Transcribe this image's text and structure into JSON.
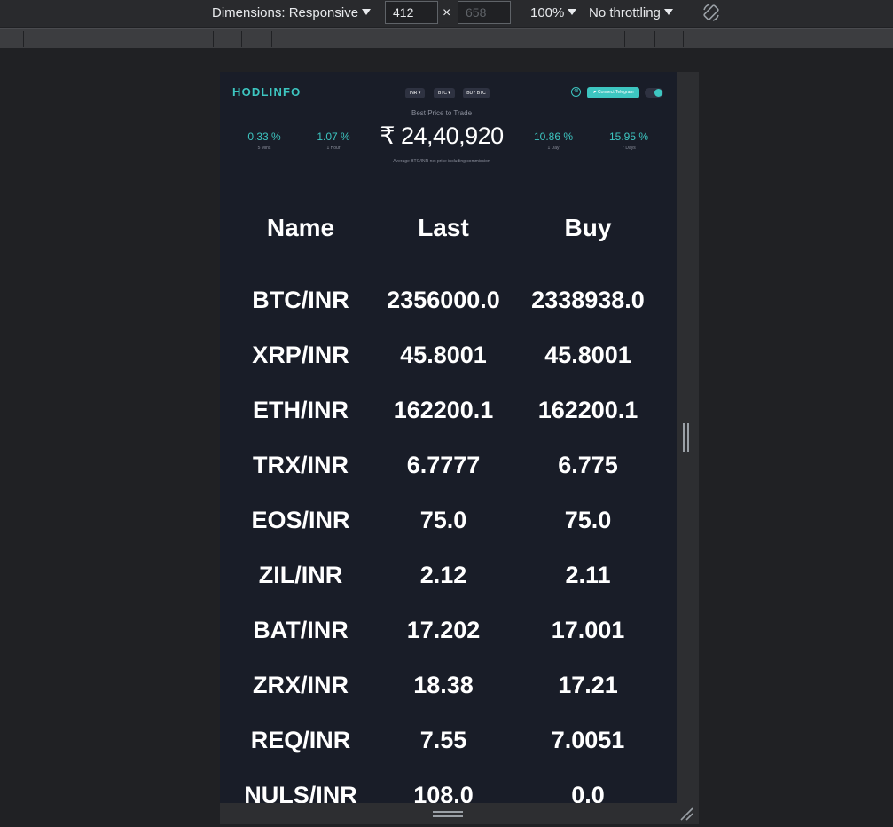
{
  "devtools": {
    "dimensions_label": "Dimensions: Responsive",
    "width_value": "412",
    "height_placeholder": "658",
    "zoom": "100%",
    "throttling": "No throttling",
    "rotate_icon": "rotate-icon"
  },
  "header": {
    "logo": "HODLINFO",
    "currency_dropdown": "INR",
    "coin_dropdown": "BTC",
    "buy_button": "BUY BTC",
    "timer": "48",
    "telegram_button": "Connect Telegram",
    "accent_color": "#3dc6c1"
  },
  "summary": {
    "best_price_label": "Best Price to Trade",
    "price": "₹ 24,40,920",
    "average_note": "Average BTC/INR net price including commission",
    "stats": [
      {
        "value": "0.33 %",
        "label": "5 Mins"
      },
      {
        "value": "1.07 %",
        "label": "1 Hour"
      },
      {
        "value": "10.86 %",
        "label": "1 Day"
      },
      {
        "value": "15.95 %",
        "label": "7 Days"
      }
    ]
  },
  "table": {
    "headers": [
      "Name",
      "Last",
      "Buy"
    ],
    "rows": [
      [
        "BTC/INR",
        "2356000.0",
        "2338938.0"
      ],
      [
        "XRP/INR",
        "45.8001",
        "45.8001"
      ],
      [
        "ETH/INR",
        "162200.1",
        "162200.1"
      ],
      [
        "TRX/INR",
        "6.7777",
        "6.775"
      ],
      [
        "EOS/INR",
        "75.0",
        "75.0"
      ],
      [
        "ZIL/INR",
        "2.12",
        "2.11"
      ],
      [
        "BAT/INR",
        "17.202",
        "17.001"
      ],
      [
        "ZRX/INR",
        "18.38",
        "17.21"
      ],
      [
        "REQ/INR",
        "7.55",
        "7.0051"
      ],
      [
        "NULS/INR",
        "108.0",
        "0.0"
      ]
    ]
  }
}
